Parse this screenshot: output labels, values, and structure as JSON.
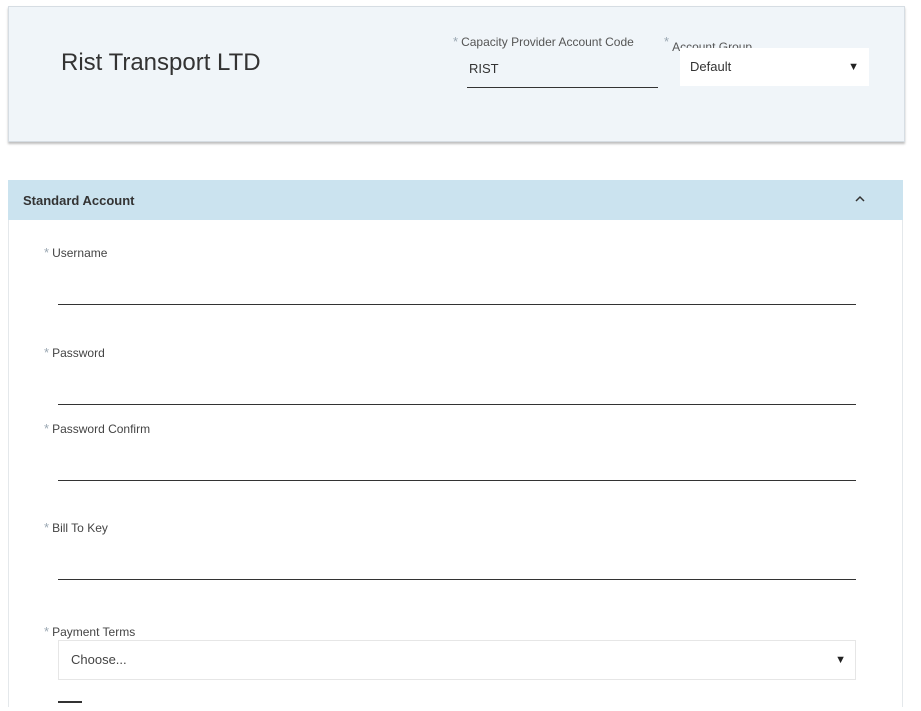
{
  "header": {
    "company_name": "Rist Transport LTD",
    "capacity_provider": {
      "label": "Capacity Provider Account Code",
      "value": "RIST",
      "required": "*"
    },
    "account_group": {
      "label": "Account Group",
      "selected": "Default",
      "required": "*"
    }
  },
  "section": {
    "title": "Standard Account",
    "collapse_icon": "chevron-up-icon",
    "fields": {
      "username": {
        "label": "Username",
        "value": ""
      },
      "password": {
        "label": "Password",
        "value": ""
      },
      "password_confirm": {
        "label": "Password Confirm",
        "value": ""
      },
      "bill_to_key": {
        "label": "Bill To Key",
        "value": ""
      },
      "payment_terms": {
        "label": "Payment Terms",
        "selected": "Choose..."
      }
    },
    "required_marker": "*"
  },
  "caret": "▼",
  "colors": {
    "header_bg": "#f0f5f9",
    "section_bg": "#cbe3ef",
    "required": "#9aa7b2"
  }
}
